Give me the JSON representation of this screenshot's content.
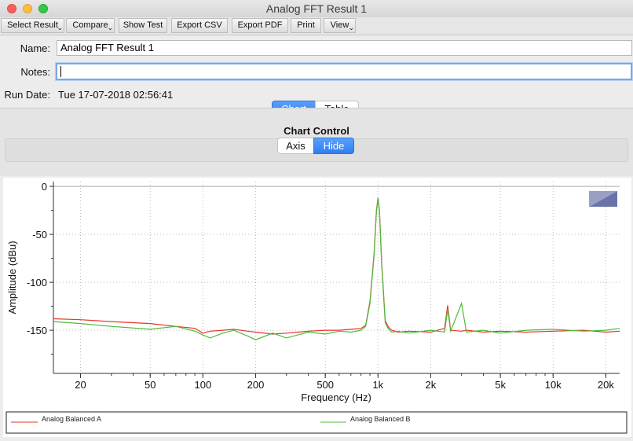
{
  "window": {
    "title": "Analog FFT Result 1"
  },
  "toolbar": {
    "buttons": [
      "Select Result",
      "Compare",
      "Show Test",
      "Export CSV",
      "Export PDF",
      "Print",
      "View"
    ]
  },
  "form": {
    "name_label": "Name:",
    "name_value": "Analog FFT Result 1",
    "notes_label": "Notes:",
    "notes_value": "",
    "rundate_label": "Run Date:",
    "rundate_value": "Tue 17-07-2018 02:56:41"
  },
  "view_tabs": {
    "chart": "Chart",
    "table": "Table",
    "selected": "Chart"
  },
  "chart_control": {
    "title": "Chart Control",
    "axis": "Axis",
    "hide": "Hide",
    "selected": "Hide"
  },
  "colors": {
    "series_a": "#e8342c",
    "series_b": "#4dbb3a",
    "accent": "#2f7ef2",
    "logo": "#6b74a8"
  },
  "chart_data": {
    "type": "line",
    "xlabel": "Frequency (Hz)",
    "ylabel": "Amplitude (dBu)",
    "x_scale": "log",
    "xlim": [
      14,
      24000
    ],
    "ylim": [
      -195,
      5
    ],
    "x_ticks": [
      20,
      50,
      100,
      200,
      500,
      1000,
      2000,
      5000,
      10000,
      20000
    ],
    "x_tick_labels": [
      "20",
      "50",
      "100",
      "200",
      "500",
      "1k",
      "2k",
      "5k",
      "10k",
      "20k"
    ],
    "y_ticks": [
      0,
      -50,
      -100,
      -150
    ],
    "y_tick_labels": [
      "0",
      "-50",
      "-100",
      "-150"
    ],
    "grid": true,
    "legend_placement": "bottom",
    "series": [
      {
        "name": "Analog Balanced A",
        "x": [
          14,
          20,
          30,
          50,
          70,
          90,
          100,
          110,
          130,
          150,
          180,
          200,
          250,
          300,
          400,
          500,
          600,
          700,
          800,
          850,
          900,
          950,
          980,
          1000,
          1020,
          1050,
          1100,
          1150,
          1200,
          1300,
          1500,
          2000,
          2400,
          2500,
          2600,
          3000,
          3200,
          4000,
          5000,
          7000,
          10000,
          15000,
          20000,
          24000
        ],
        "y": [
          -138,
          -139,
          -141,
          -143,
          -146,
          -148,
          -153,
          -151,
          -150,
          -149,
          -151,
          -152,
          -154,
          -153,
          -151,
          -150,
          -150,
          -149,
          -148,
          -145,
          -120,
          -70,
          -25,
          -12,
          -25,
          -80,
          -140,
          -147,
          -150,
          -152,
          -151,
          -152,
          -148,
          -124,
          -150,
          -151,
          -150,
          -152,
          -151,
          -152,
          -151,
          -150,
          -152,
          -151
        ]
      },
      {
        "name": "Analog Balanced B",
        "x": [
          14,
          20,
          30,
          50,
          70,
          90,
          100,
          110,
          130,
          150,
          180,
          200,
          250,
          300,
          400,
          500,
          600,
          700,
          800,
          850,
          900,
          950,
          980,
          1000,
          1020,
          1050,
          1100,
          1150,
          1200,
          1300,
          1500,
          2000,
          2400,
          2500,
          2600,
          3000,
          3200,
          4000,
          5000,
          7000,
          10000,
          15000,
          20000,
          24000
        ],
        "y": [
          -141,
          -143,
          -146,
          -149,
          -146,
          -151,
          -155,
          -158,
          -153,
          -150,
          -156,
          -160,
          -153,
          -158,
          -152,
          -154,
          -151,
          -152,
          -150,
          -146,
          -122,
          -72,
          -27,
          -12,
          -27,
          -82,
          -142,
          -149,
          -152,
          -151,
          -153,
          -150,
          -152,
          -128,
          -151,
          -122,
          -152,
          -150,
          -153,
          -150,
          -149,
          -151,
          -150,
          -148
        ]
      }
    ]
  }
}
